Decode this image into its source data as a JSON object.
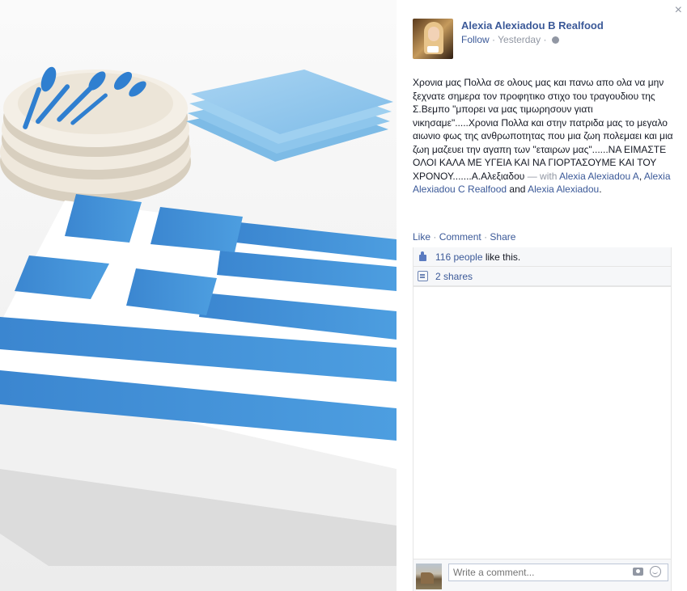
{
  "author": {
    "name": "Alexia Alexiadou B Realfood",
    "follow_label": "Follow",
    "separator": "·",
    "time": "Yesterday",
    "separator2": "·"
  },
  "close_label": "×",
  "post": {
    "body": "Χρονια μας Πολλα σε ολους μας και πανω απο ολα να μην ξεχνατε σημερα τον προφητικο στιχο του τραγουδιου της Σ.Βεμπο \"μπορει να μας τιμωρησουν γιατι νικησαμε\".....Χρονια Πολλα και στην πατριδα μας το μεγαλο αιωνιο φως της ανθρωποτητας που μια ζωη πολεμαει και μια ζωη μαζευει την αγαπη των \"εταιρων μας\"......ΝΑ ΕΙΜΑΣΤΕ ΟΛΟΙ ΚΑΛΑ ΜΕ ΥΓΕΙΑ ΚΑΙ ΝΑ ΓΙΟΡΤΑΣΟΥΜΕ ΚΑΙ ΤΟΥ ΧΡΟΝΟΥ.......Α.Αλεξιαδου",
    "with_prefix": "— with",
    "tag1": "Alexia Alexiadou A",
    "comma": ",",
    "tag2": "Alexia Alexiadou C Realfood",
    "and": "and",
    "tag3": "Alexia Alexiadou",
    "period": "."
  },
  "actions": {
    "like": "Like",
    "dot1": "·",
    "comment": "Comment",
    "dot2": "·",
    "share": "Share"
  },
  "ufi": {
    "likes_link": "116 people",
    "likes_text": "like this.",
    "shares_link": "2 shares"
  },
  "composer": {
    "placeholder": "Write a comment..."
  },
  "colors": {
    "link": "#3b5998",
    "flag_blue": "#3f8fd6",
    "muted": "#9197a3"
  }
}
